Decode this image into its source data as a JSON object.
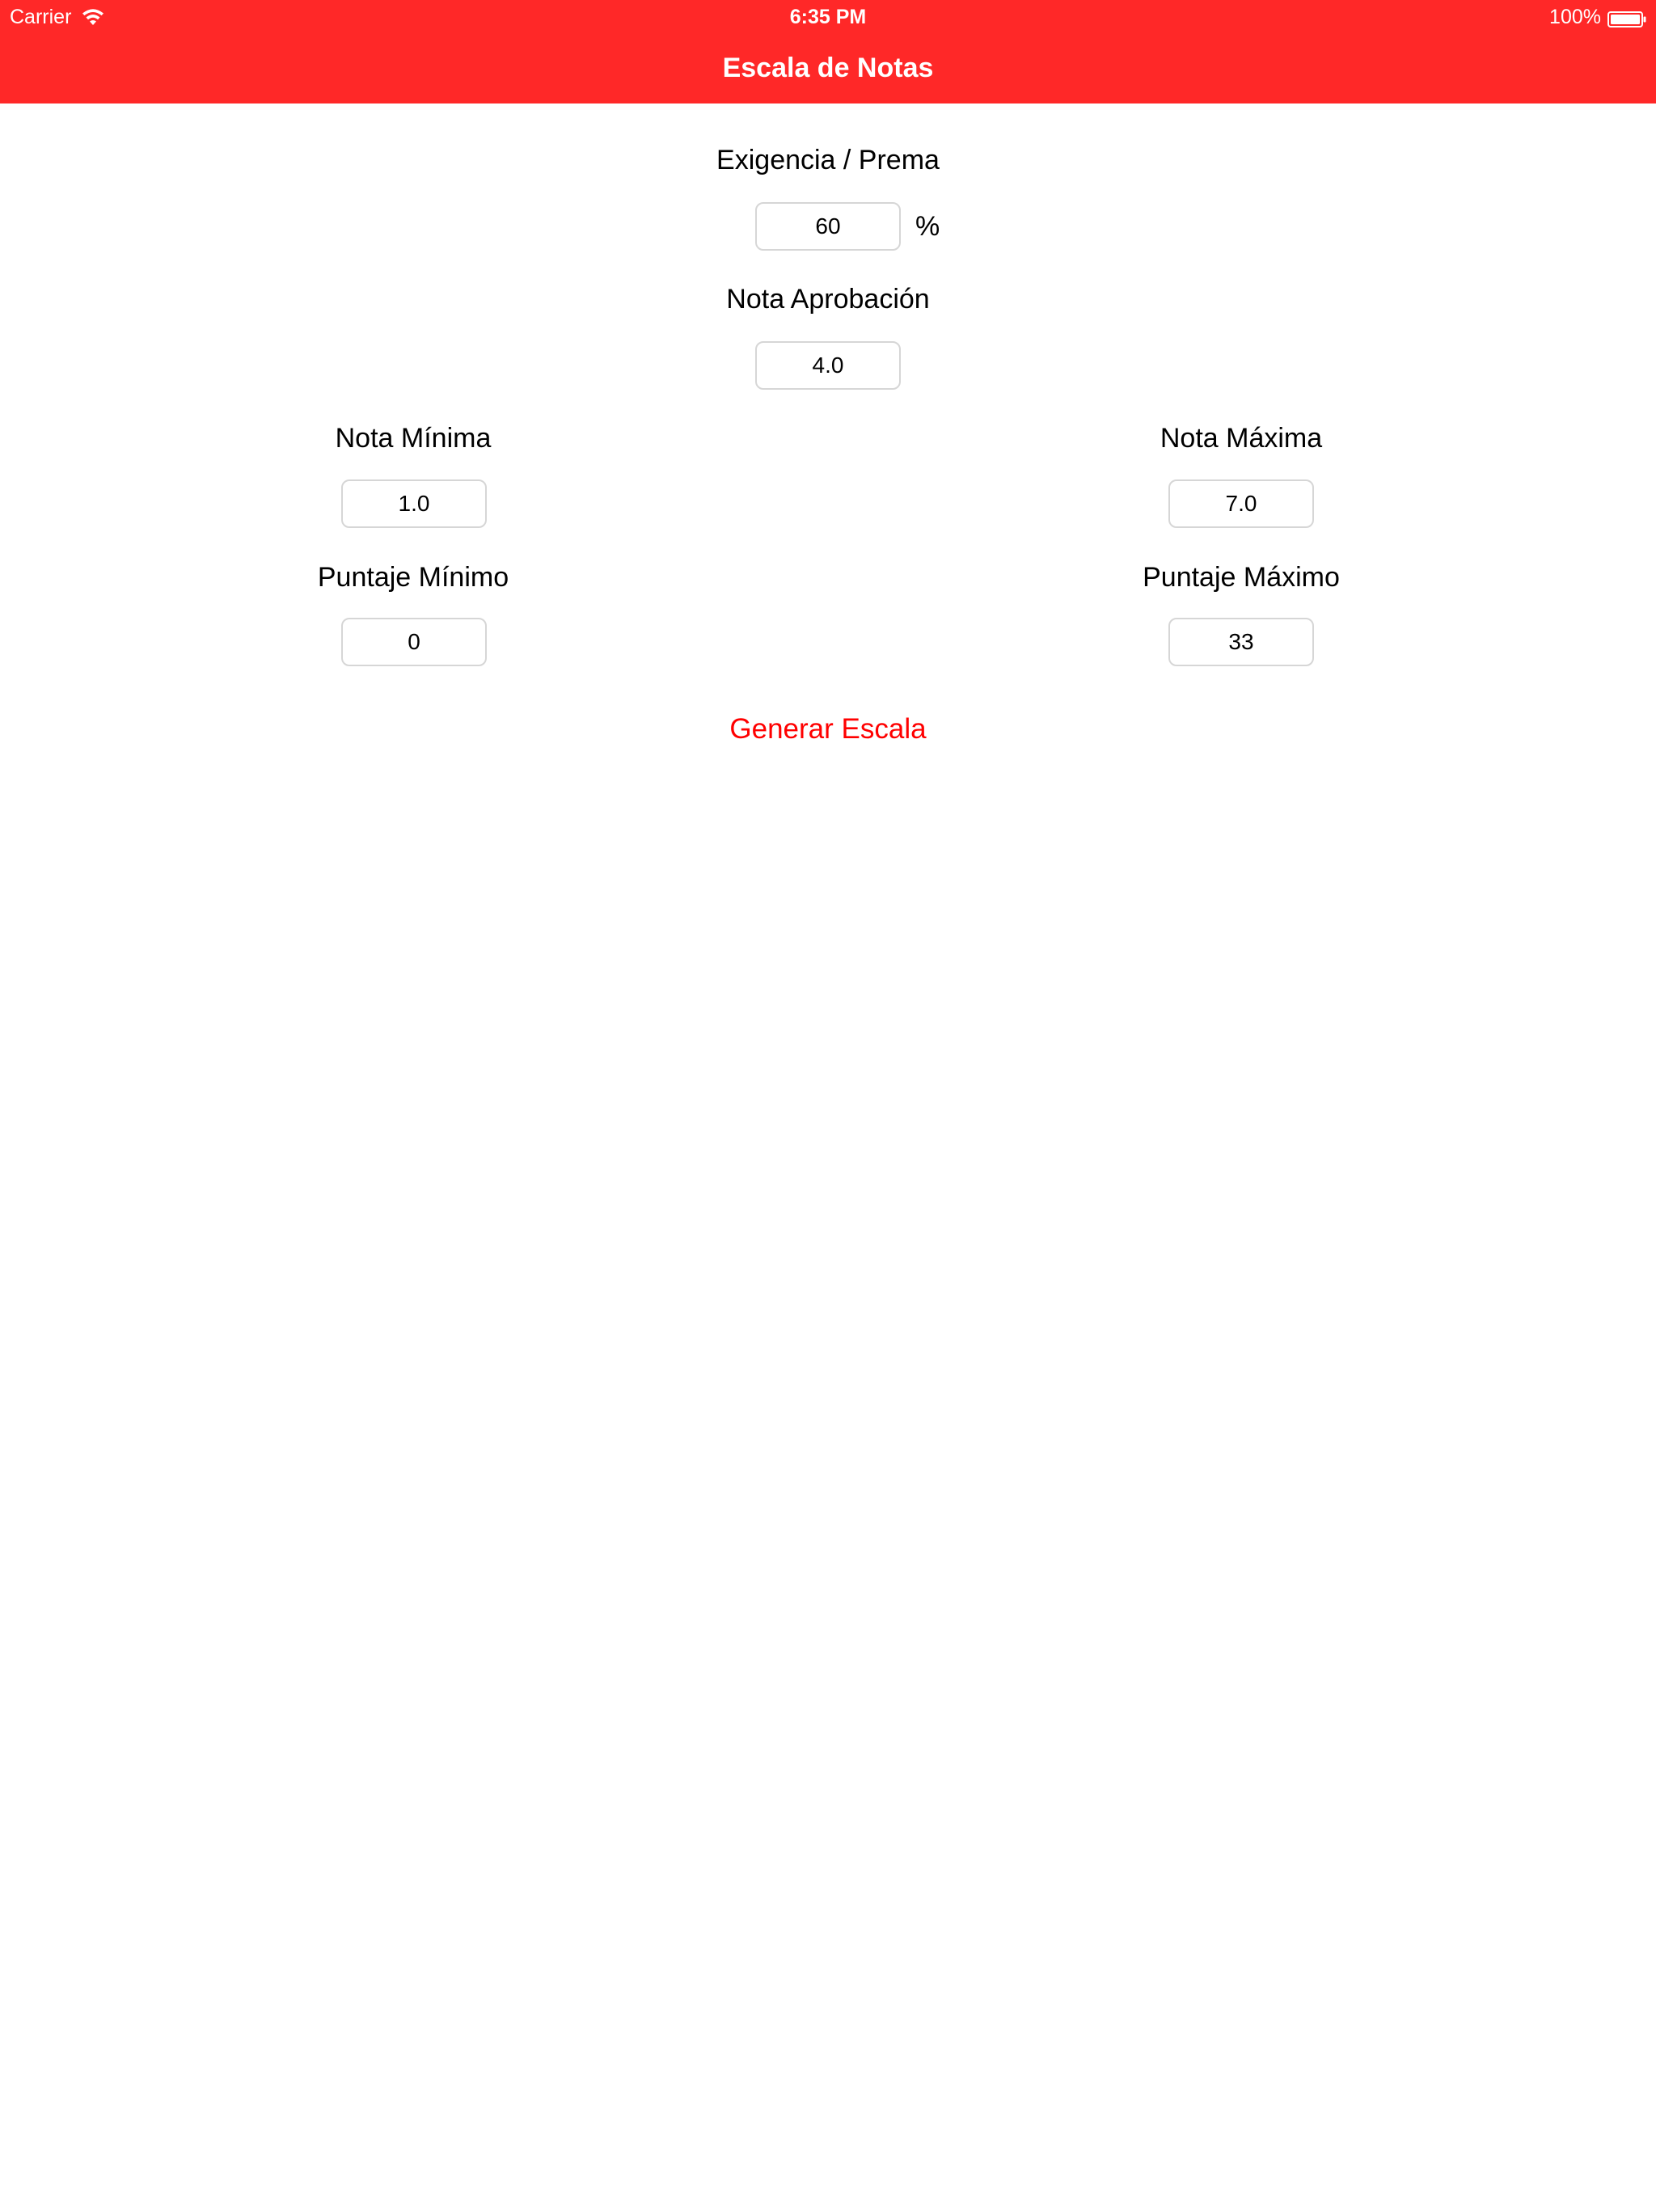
{
  "status_bar": {
    "carrier": "Carrier",
    "time": "6:35 PM",
    "battery": "100%",
    "wifi_icon": "wifi-icon",
    "battery_icon": "battery-icon"
  },
  "nav": {
    "title": "Escala de Notas",
    "background_color": "#ff2828",
    "title_color": "#ffffff"
  },
  "form": {
    "exigencia": {
      "label": "Exigencia / Prema",
      "value": "60",
      "suffix": "%"
    },
    "nota_aprobacion": {
      "label": "Nota Aprobación",
      "value": "4.0"
    },
    "nota_minima": {
      "label": "Nota Mínima",
      "value": "1.0"
    },
    "nota_maxima": {
      "label": "Nota Máxima",
      "value": "7.0"
    },
    "puntaje_minimo": {
      "label": "Puntaje Mínimo",
      "value": "0"
    },
    "puntaje_maximo": {
      "label": "Puntaje Máximo",
      "value": "33"
    }
  },
  "actions": {
    "generate_label": "Generar Escala",
    "generate_color": "#ff0000"
  }
}
